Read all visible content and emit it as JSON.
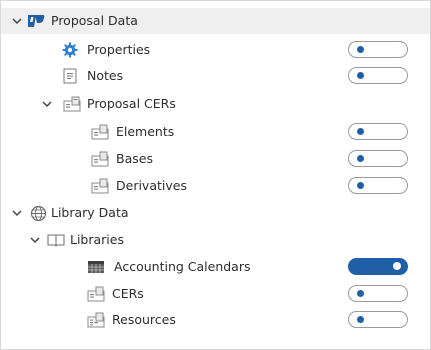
{
  "tree": {
    "proposal_data": {
      "label": "Proposal Data",
      "icon": "proposal-logo-icon"
    },
    "properties": {
      "label": "Properties",
      "icon": "gear-icon",
      "toggle_on": false
    },
    "notes": {
      "label": "Notes",
      "icon": "notes-icon",
      "toggle_on": false
    },
    "proposal_cers": {
      "label": "Proposal CERs",
      "icon": "cer-folder-icon"
    },
    "elements": {
      "label": "Elements",
      "icon": "cer-icon",
      "toggle_on": false
    },
    "bases": {
      "label": "Bases",
      "icon": "cer-icon",
      "toggle_on": false
    },
    "derivatives": {
      "label": "Derivatives",
      "icon": "cer-icon",
      "toggle_on": false
    },
    "library_data": {
      "label": "Library Data",
      "icon": "globe-icon"
    },
    "libraries": {
      "label": "Libraries",
      "icon": "book-icon"
    },
    "accounting_calendars": {
      "label": "Accounting Calendars",
      "icon": "calendar-grid-icon",
      "toggle_on": true
    },
    "cers": {
      "label": "CERs",
      "icon": "cer-icon",
      "toggle_on": false
    },
    "resources": {
      "label": "Resources",
      "icon": "resources-icon",
      "toggle_on": false
    }
  },
  "colors": {
    "accent": "#1e5fa6",
    "header_bg": "#efefef",
    "toggle_border": "#9a9a9a"
  }
}
